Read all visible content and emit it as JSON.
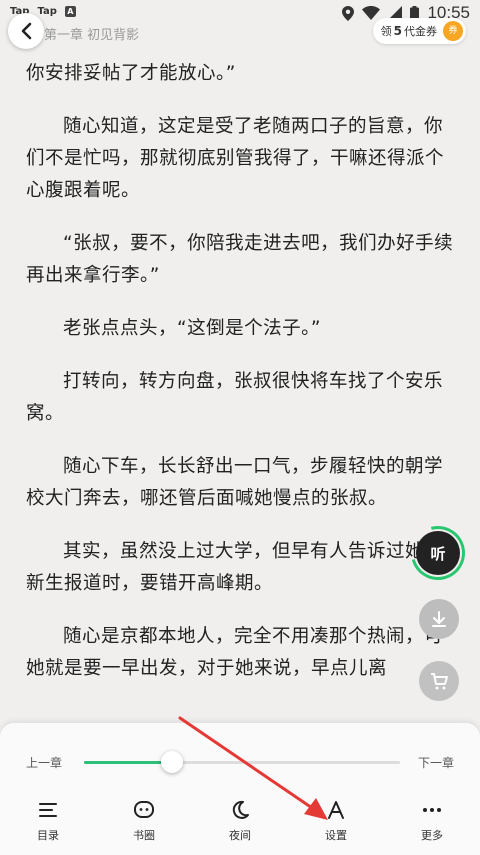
{
  "status_bar": {
    "left_icons": [
      "Tap",
      "Tap",
      "A"
    ],
    "time": "10:55"
  },
  "header": {
    "chapter_title": "第一章 初见背影",
    "coupon": {
      "prefix": "领",
      "count": "5",
      "suffix": "代金券",
      "icon_text": "券"
    }
  },
  "content": {
    "paragraphs": [
      "你安排妥帖了才能放心。”",
      "随心知道，这定是受了老随两口子的旨意，你们不是忙吗，那就彻底别管我得了，干嘛还得派个心腹跟着呢。",
      "“张叔，要不，你陪我走进去吧，我们办好手续再出来拿行李。”",
      "老张点点头，“这倒是个法子。”",
      "打转向，转方向盘，张叔很快将车找了个安乐窝。",
      "随心下车，长长舒出一口气，步履轻快的朝学校大门奔去，哪还管后面喊她慢点的张叔。",
      "其实，虽然没上过大学，但早有人告诉过她，新生报道时，要错开高峰期。",
      "随心是京都本地人，完全不用凑那个热闹，可她就是要一早出发，对于她来说，早点儿离"
    ]
  },
  "floating": {
    "listen_label": "听"
  },
  "bottom_panel": {
    "prev_chapter": "上一章",
    "next_chapter": "下一章",
    "progress": 0.28,
    "tools": [
      {
        "label": "目录",
        "icon": "menu-icon"
      },
      {
        "label": "书圈",
        "icon": "chat-icon"
      },
      {
        "label": "夜间",
        "icon": "moon-icon"
      },
      {
        "label": "设置",
        "icon": "font-icon"
      },
      {
        "label": "更多",
        "icon": "more-icon"
      }
    ]
  },
  "colors": {
    "accent": "#2bbf78",
    "arrow": "#e53935",
    "coupon": "#f6a623"
  }
}
